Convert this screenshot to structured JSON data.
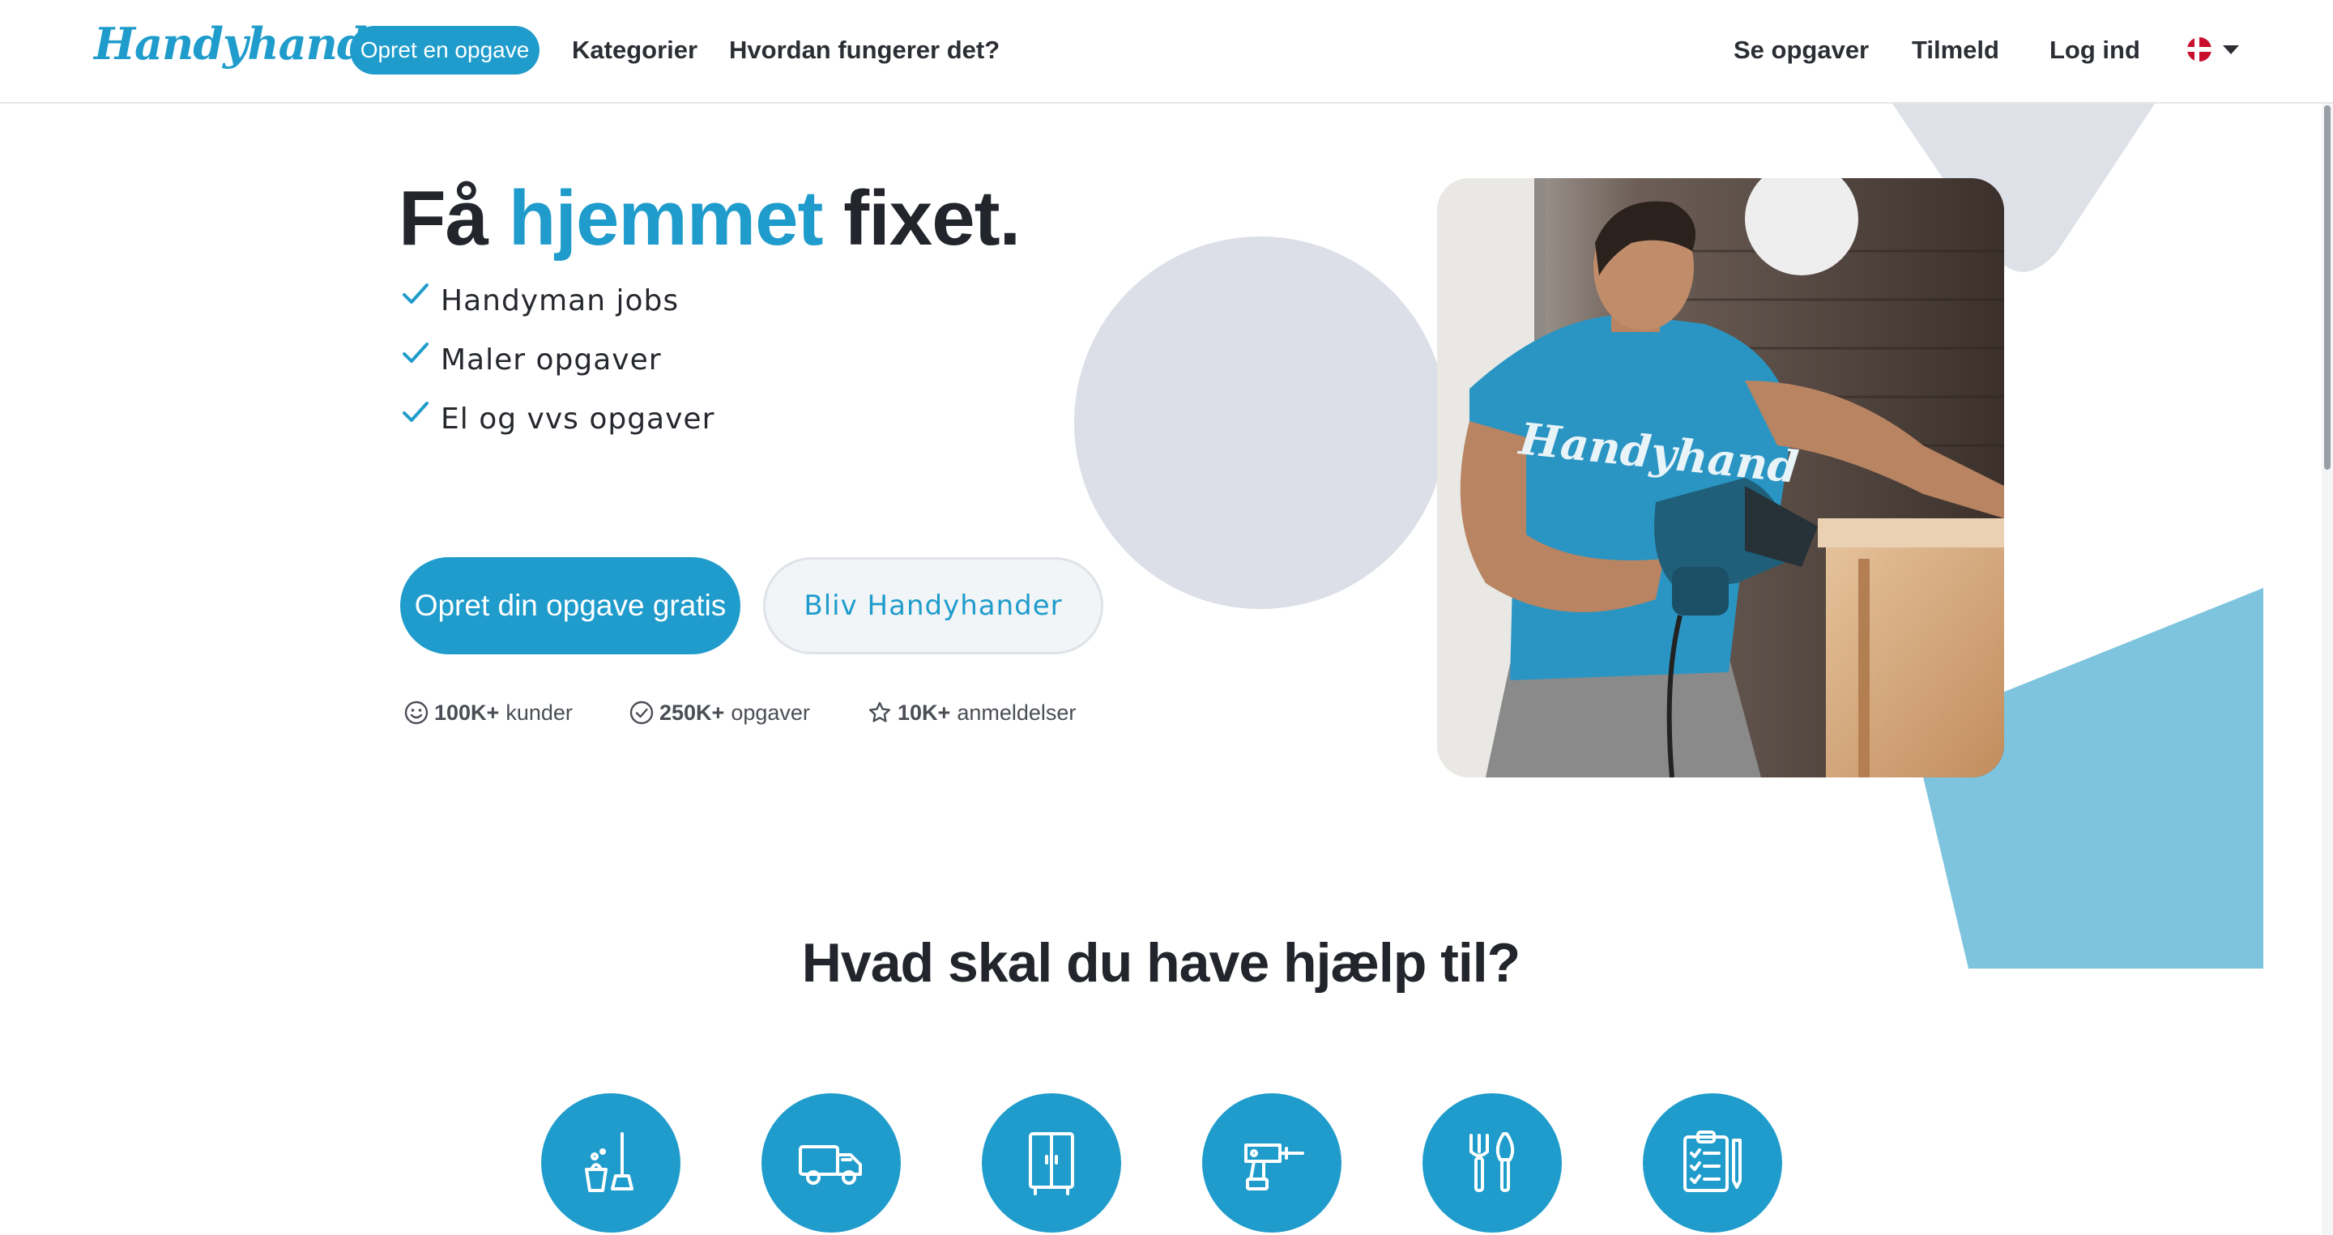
{
  "header": {
    "logo_text": "Handyhand",
    "create_task_label": "Opret en opgave",
    "nav_left": [
      "Kategorier",
      "Hvordan fungerer det?"
    ],
    "nav_right": [
      "Se opgaver",
      "Tilmeld",
      "Log ind"
    ],
    "language_icon": "denmark-flag-icon"
  },
  "hero": {
    "title_part1": "Få ",
    "title_accent": "hjemmet",
    "title_part2": " fixet.",
    "checklist": [
      "Handyman jobs",
      "Maler opgaver",
      "El og vvs opgaver"
    ],
    "primary_button": "Opret din opgave gratis",
    "secondary_button": "Bliv Handyhander",
    "stats": [
      {
        "icon": "smiley-icon",
        "value": "100K+",
        "label": "kunder"
      },
      {
        "icon": "check-circle-icon",
        "value": "250K+",
        "label": "opgaver"
      },
      {
        "icon": "star-icon",
        "value": "10K+",
        "label": "anmeldelser"
      }
    ],
    "photo_shirt_text": "Handyhand"
  },
  "help": {
    "title": "Hvad skal du have hjælp til?",
    "categories": [
      {
        "icon": "cleaning-icon"
      },
      {
        "icon": "moving-truck-icon"
      },
      {
        "icon": "furniture-cabinet-icon"
      },
      {
        "icon": "drill-icon"
      },
      {
        "icon": "garden-tools-icon"
      },
      {
        "icon": "checklist-icon"
      }
    ]
  },
  "colors": {
    "accent": "#1f9ccb",
    "light_blue": "#7ec4de",
    "grey_shape": "#dcdfe8",
    "text": "#22252b"
  }
}
